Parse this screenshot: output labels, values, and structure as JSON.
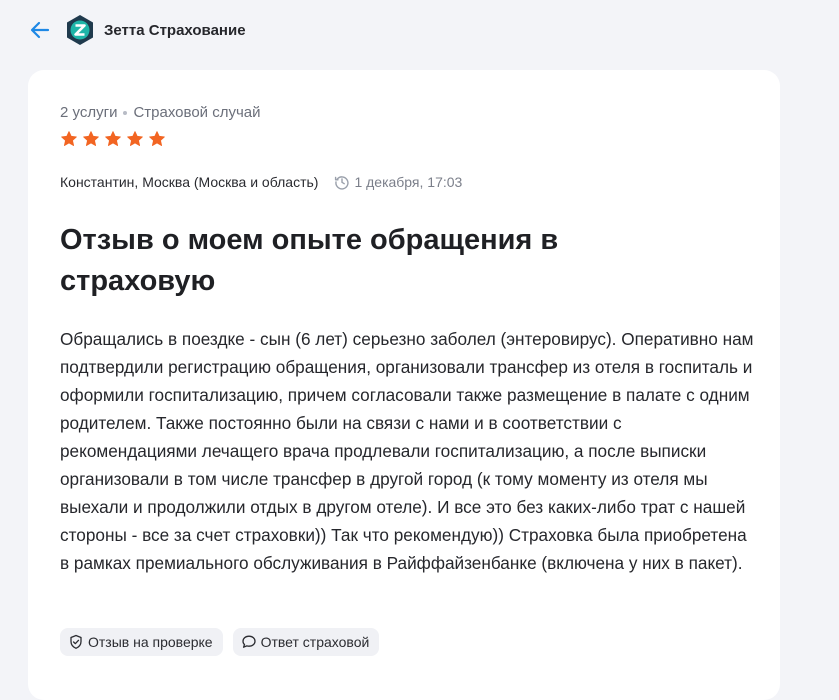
{
  "header": {
    "company_name": "Зетта Страхование",
    "logo_letter": "Z",
    "back_icon": "arrow-left-icon"
  },
  "review": {
    "services_count": "2 услуги",
    "category": "Страховой случай",
    "rating": 5,
    "rating_max": 5,
    "author": "Константин, Москва (Москва и область)",
    "date": "1 декабря, 17:03",
    "title": "Отзыв о моем опыте обращения в страховую",
    "body": "Обращались в поездке - сын (6 лет) серьезно заболел (энтеровирус). Оперативно нам подтвердили регистрацию обращения, организовали трансфер из отеля в госпиталь и оформили госпитализацию, причем согласовали также размещение в палате с одним родителем. Также постоянно были на связи с нами и в соответствии с рекомендациями лечащего врача продлевали госпитализацию, а после выписки организовали в том числе трансфер в другой город (к тому моменту из отеля мы выехали и продолжили отдых в другом отеле). И все это без каких-либо трат с нашей стороны - все за счет страховки)) Так что рекомендую)) Страховка была приобретена в рамках премиального обслуживания в Райффайзенбанке (включена у них в пакет).",
    "tags": [
      {
        "label": "Отзыв на проверке",
        "icon": "shield-check-icon"
      },
      {
        "label": "Ответ страховой",
        "icon": "chat-bubble-icon"
      }
    ]
  },
  "colors": {
    "accent": "#1e88e5",
    "star": "#f26522",
    "logo_dark": "#1f3a4d",
    "logo_teal": "#1fb5a8"
  }
}
